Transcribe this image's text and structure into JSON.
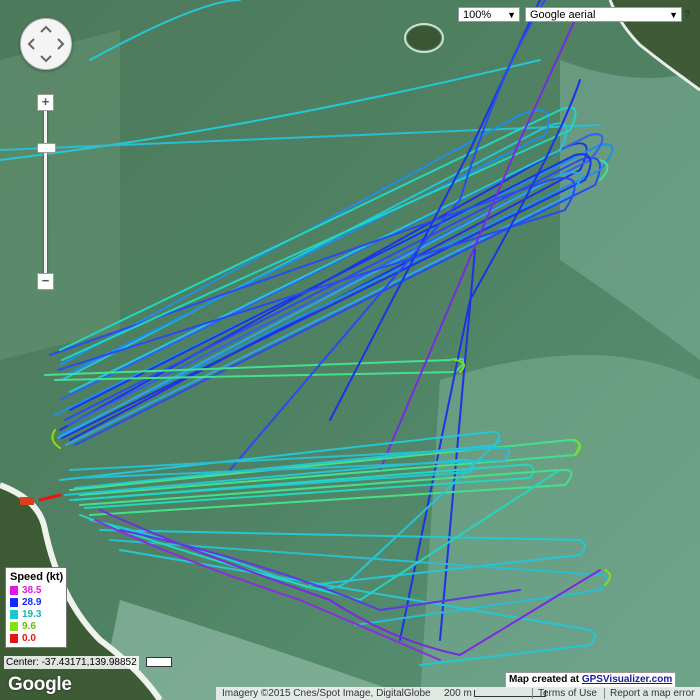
{
  "map": {
    "zoom_label": "100%",
    "maptype_label": "Google aerial",
    "help_label": "?",
    "zoom_in_label": "+",
    "zoom_out_label": "−"
  },
  "legend": {
    "title": "Speed (kt)",
    "entries": [
      {
        "label": "38.5",
        "color": "#e019e0"
      },
      {
        "label": "28.9",
        "color": "#1428ff"
      },
      {
        "label": "19.3",
        "color": "#19c8c8"
      },
      {
        "label": "9.6",
        "color": "#8cdc14"
      },
      {
        "label": "0.0",
        "color": "#e61414"
      }
    ]
  },
  "status": {
    "center_text": "Center: -37.43171,139.98852",
    "google_logo": "Google",
    "credit_prefix": "Map created at ",
    "credit_link": "GPSVisualizer.com",
    "imagery": "Imagery ©2015 Cnes/Spot Image, DigitalGlobe",
    "scale": "200 m",
    "terms": "Terms of Use",
    "report": "Report a map error"
  },
  "colors": {
    "water": "#4f7d5e",
    "shallow": "#7fb39c",
    "track_blue": "#1b34e6",
    "track_cyan": "#25c6d6",
    "track_green": "#45e08a",
    "track_purple": "#7a2ae0"
  }
}
